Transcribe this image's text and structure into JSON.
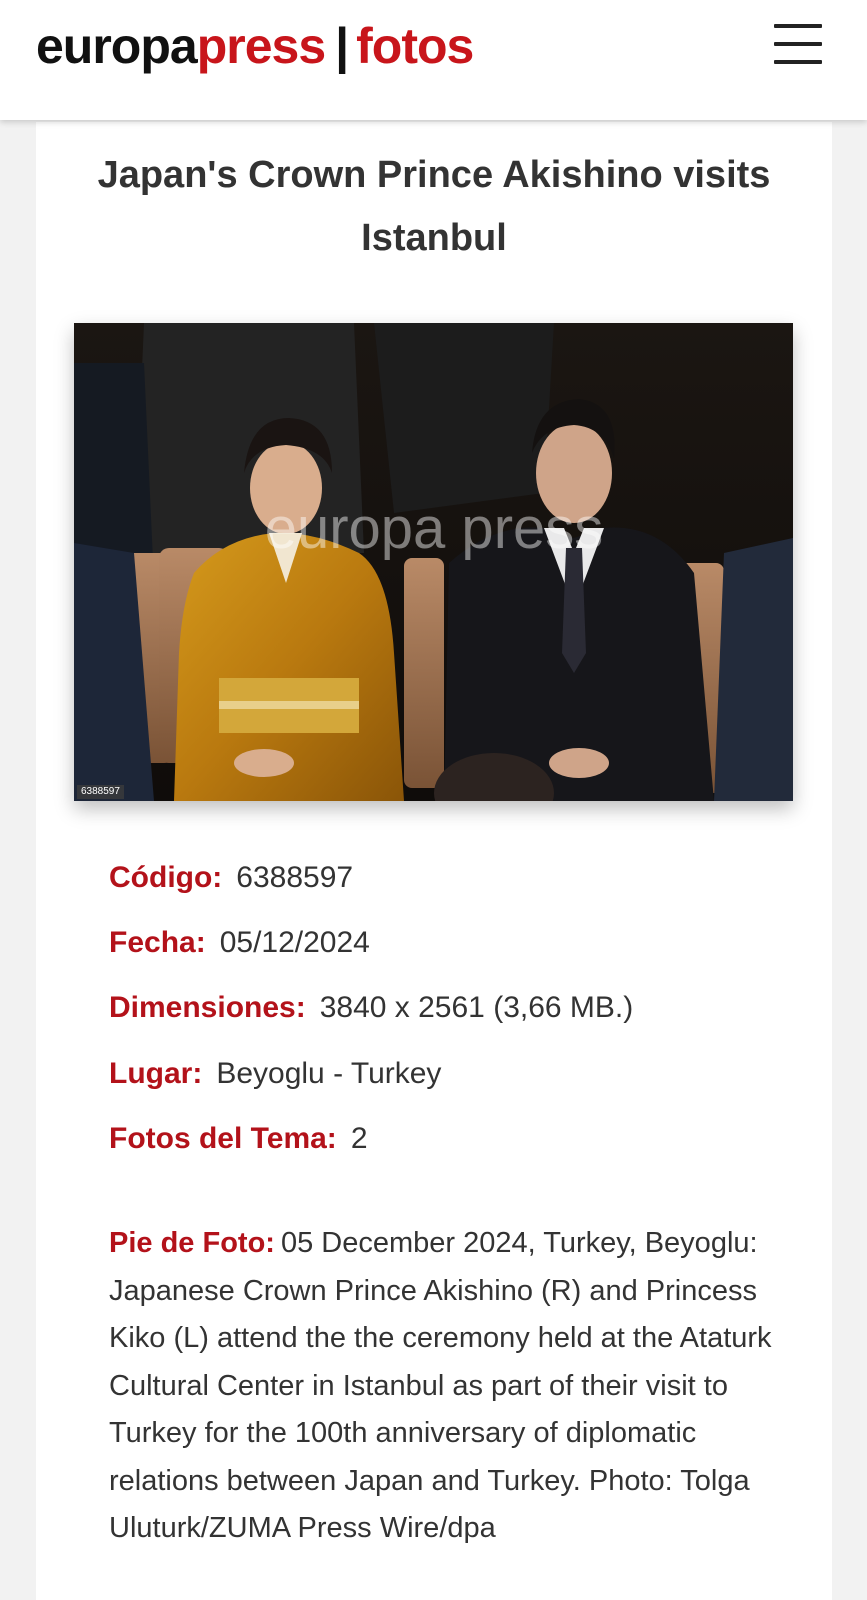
{
  "header": {
    "logo_part1": "europa",
    "logo_part2": "press",
    "logo_separator": "|",
    "logo_part3": "fotos",
    "menu_icon": "hamburger-menu-icon"
  },
  "article": {
    "title": "Japan's Crown Prince Akishino visits Istanbul",
    "photo": {
      "watermark": "europa press",
      "id_label": "6388597"
    },
    "details": [
      {
        "label": "Código:",
        "value": "6388597"
      },
      {
        "label": "Fecha:",
        "value": "05/12/2024"
      },
      {
        "label": "Dimensiones:",
        "value": "3840 x 2561 (3,66 MB.)"
      },
      {
        "label": "Lugar:",
        "value": "Beyoglu - Turkey"
      },
      {
        "label": "Fotos del Tema:",
        "value": "2"
      }
    ],
    "caption_label": "Pie de Foto:",
    "caption_text": "05 December 2024, Turkey, Beyoglu: Japanese Crown Prince Akishino (R) and Princess Kiko (L) attend the the ceremony held at the Ataturk Cultural Center in Istanbul as part of their visit to Turkey for the 100th anniversary of diplomatic relations between Japan and Turkey. Photo: Tolga Uluturk/ZUMA Press Wire/dpa"
  },
  "colors": {
    "brand_red": "#c8151b",
    "label_red": "#b3121a",
    "text_dark": "#333333",
    "page_bg": "#f2f2f2"
  }
}
